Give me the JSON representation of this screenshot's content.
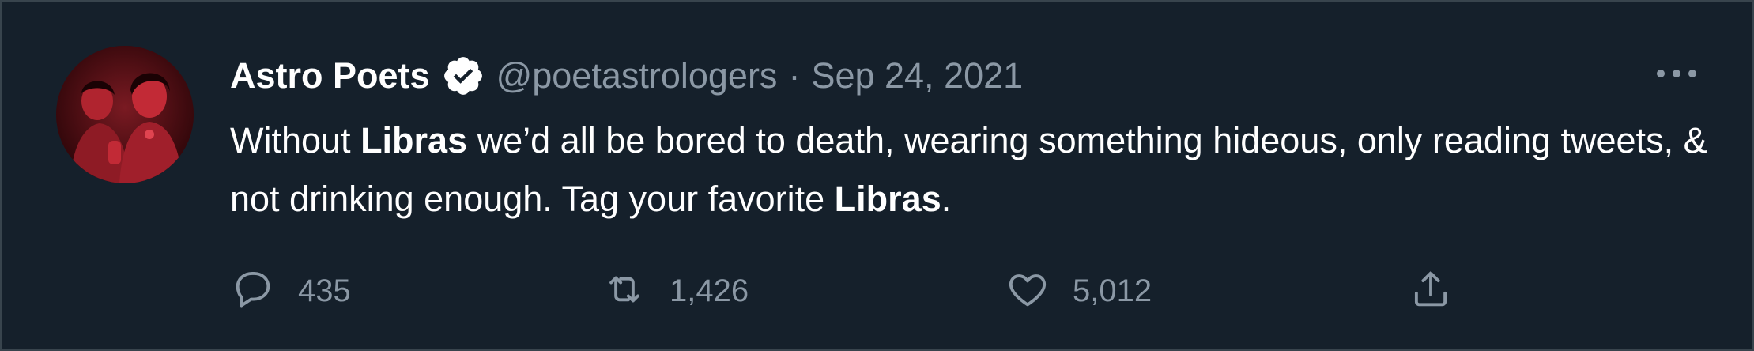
{
  "tweet": {
    "display_name": "Astro Poets",
    "handle": "@poetastrologers",
    "separator": "·",
    "date": "Sep 24, 2021",
    "text_parts": {
      "p1": "Without ",
      "b1": "Libras",
      "p2": " we’d all be bored to death, wearing something hideous, only reading tweets, & not drinking enough. Tag your favorite ",
      "b2": "Libras",
      "p3": "."
    },
    "actions": {
      "reply_count": "435",
      "retweet_count": "1,426",
      "like_count": "5,012"
    }
  },
  "icons": {
    "verified": "verified-badge-icon",
    "more": "more-options-icon",
    "reply": "reply-icon",
    "retweet": "retweet-icon",
    "like": "heart-icon",
    "share": "share-icon"
  },
  "colors": {
    "background": "#15202b",
    "text_primary": "#ffffff",
    "text_secondary": "#8b98a5",
    "border": "#38444d"
  }
}
